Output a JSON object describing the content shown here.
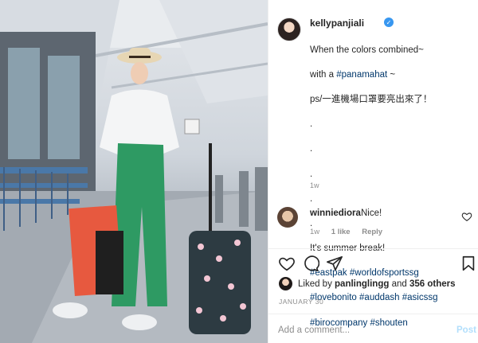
{
  "post": {
    "username": "kellypanjiali",
    "verified_glyph": "✓",
    "caption_lines": [
      "When the colors combined~",
      "with a ",
      "#panamahat",
      " ~",
      "ps/一進機場口罩要亮出來了！",
      ".",
      ".",
      ".",
      ".",
      ".",
      "It's summer break!",
      "#eastpak",
      "#worldofsportssg",
      "#lovebonito",
      "#auddash",
      "#asicssg",
      "#birocompany",
      "#shouten"
    ],
    "time_ago": "1w"
  },
  "comment": {
    "username": "winniediora",
    "text": "Nice!",
    "time": "1w",
    "likes": "1 like",
    "reply": "Reply"
  },
  "likes": {
    "prefix": "Liked by ",
    "liker": "panlinglingg",
    "joiner": " and ",
    "others": "356 others"
  },
  "date": "JANUARY 30",
  "composer": {
    "placeholder": "Add a comment...",
    "post_label": "Post"
  },
  "icons": {
    "like": "heart-icon",
    "comment": "comment-icon",
    "share": "share-icon",
    "save": "bookmark-icon",
    "verified": "verified-badge-icon"
  },
  "colors": {
    "verified": "#3897f0",
    "hashtag": "#00376b",
    "muted": "#8e8e8e",
    "post_disabled": "#b2dffc"
  }
}
